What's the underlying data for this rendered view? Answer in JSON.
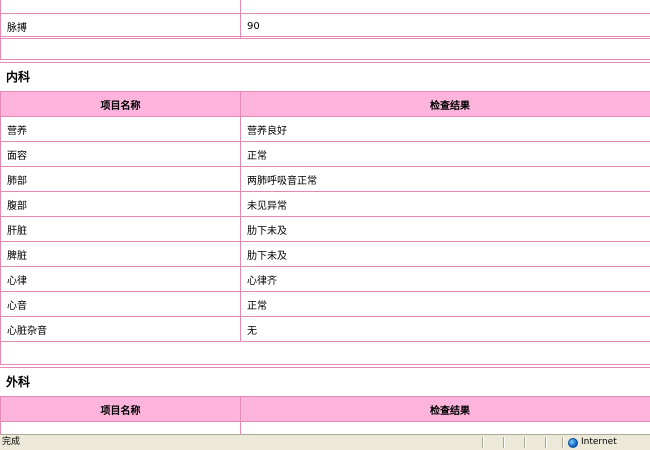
{
  "sections": [
    {
      "rows": [
        {
          "name": "脉搏",
          "result": "90"
        }
      ]
    },
    {
      "title": "内科",
      "header": {
        "name": "项目名称",
        "result": "检查结果"
      },
      "rows": [
        {
          "name": "营养",
          "result": "营养良好"
        },
        {
          "name": "面容",
          "result": "正常"
        },
        {
          "name": "肺部",
          "result": "两肺呼吸音正常"
        },
        {
          "name": "腹部",
          "result": "未见异常"
        },
        {
          "name": "肝脏",
          "result": "肋下未及"
        },
        {
          "name": "脾脏",
          "result": "肋下未及"
        },
        {
          "name": "心律",
          "result": "心律齐"
        },
        {
          "name": "心音",
          "result": "正常"
        },
        {
          "name": "心脏杂音",
          "result": "无"
        }
      ]
    },
    {
      "title": "外科",
      "header": {
        "name": "项目名称",
        "result": "检查结果"
      }
    }
  ],
  "statusbar": {
    "text": "完成",
    "zone": "Internet",
    "zone_icon": "globe-icon"
  },
  "colors": {
    "border": "#e48ab4",
    "header_bg": "#fcb4dc",
    "statusbar_bg": "#ece9d8"
  }
}
